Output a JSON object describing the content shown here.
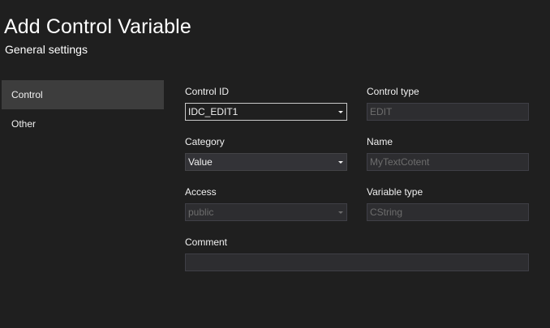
{
  "dialog": {
    "title": "Add Control Variable",
    "subtitle": "General settings"
  },
  "nav": {
    "items": [
      {
        "label": "Control",
        "selected": true
      },
      {
        "label": "Other",
        "selected": false
      }
    ]
  },
  "fields": {
    "control_id": {
      "label": "Control ID",
      "value": "IDC_EDIT1"
    },
    "control_type": {
      "label": "Control type",
      "value": "EDIT"
    },
    "category": {
      "label": "Category",
      "value": "Value"
    },
    "name": {
      "label": "Name",
      "value": "MyTextCotent"
    },
    "access": {
      "label": "Access",
      "value": "public"
    },
    "variable_type": {
      "label": "Variable type",
      "value": "CString"
    },
    "comment": {
      "label": "Comment",
      "value": ""
    }
  },
  "colors": {
    "background": "#1f1f1f",
    "selected_nav": "#3d3d3d",
    "input_background": "#333337",
    "disabled_text": "#6d6d6d"
  }
}
